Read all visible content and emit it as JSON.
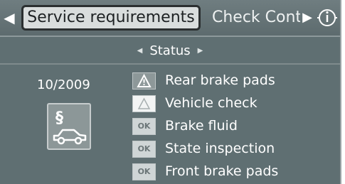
{
  "tabbar": {
    "active_tab": "Service requirements",
    "next_tab": "Check Cont"
  },
  "status": {
    "title": "Status"
  },
  "service": {
    "date": "10/2009",
    "icon": "service-section-car-icon"
  },
  "requirements": [
    {
      "label": "Rear brake pads",
      "icon": "warning-triangle-icon",
      "state": "due"
    },
    {
      "label": "Vehicle check",
      "icon": "warning-triangle-outline-icon",
      "state": "soon"
    },
    {
      "label": "Brake fluid",
      "icon": "ok-icon",
      "badge": "OK",
      "state": "ok"
    },
    {
      "label": "State inspection",
      "icon": "ok-icon",
      "badge": "OK",
      "state": "ok"
    },
    {
      "label": "Front brake pads",
      "icon": "ok-icon",
      "badge": "OK",
      "state": "ok"
    }
  ]
}
